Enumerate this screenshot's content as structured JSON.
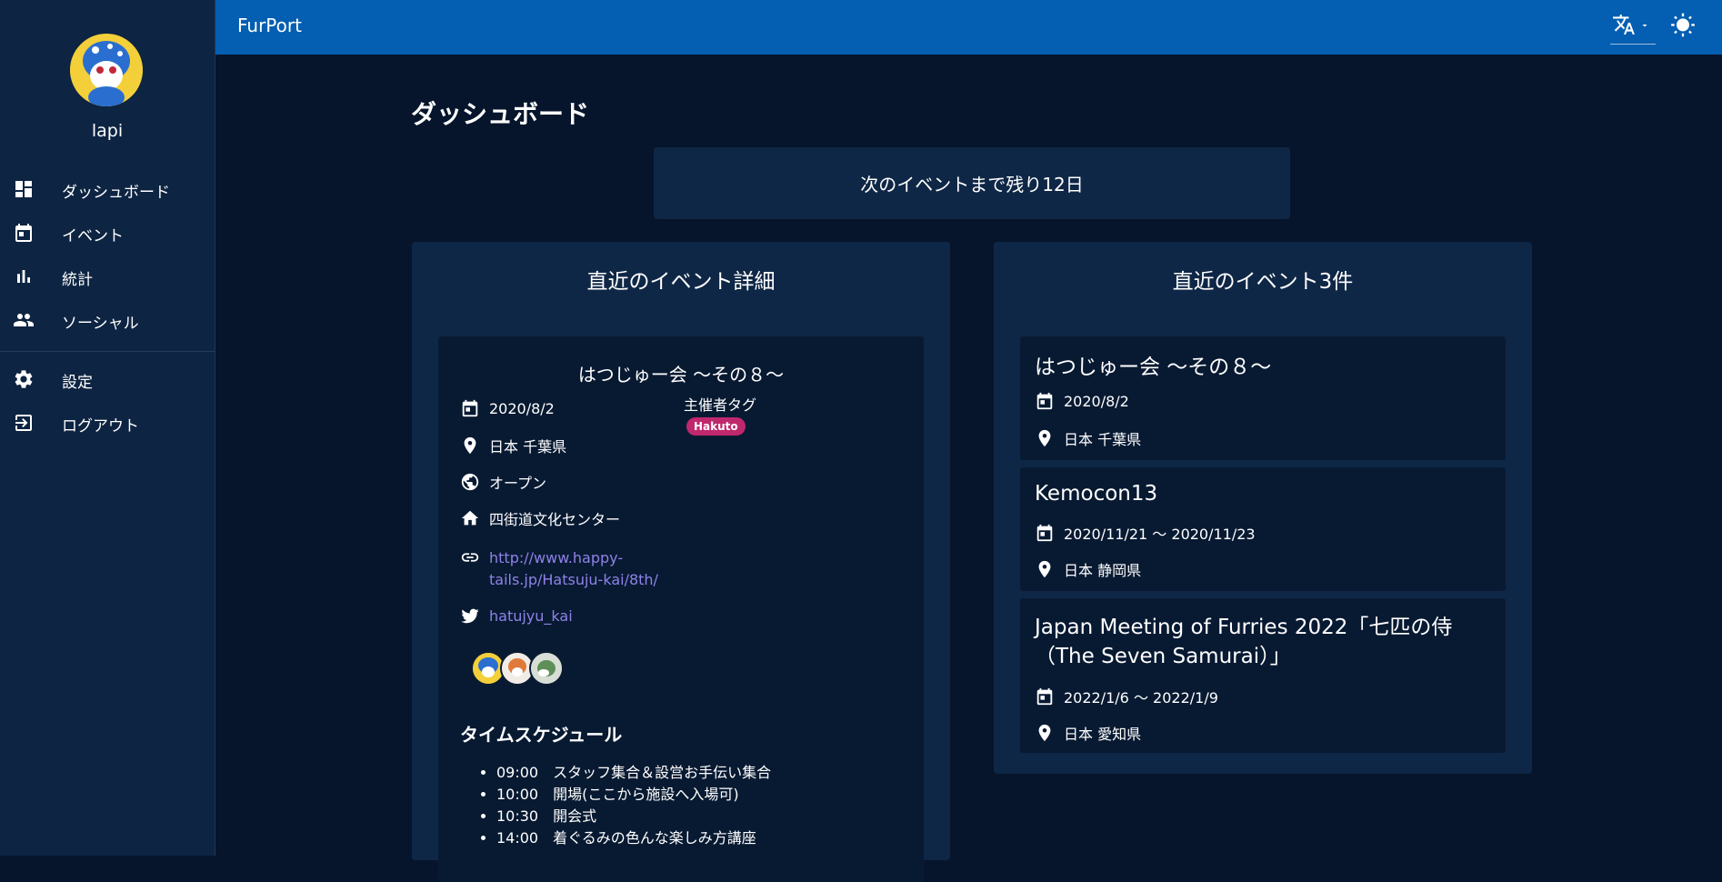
{
  "app": {
    "title": "FurPort"
  },
  "user": {
    "name": "lapi"
  },
  "sidebar": {
    "items": [
      {
        "label": "ダッシュボード",
        "icon": "dashboard-icon"
      },
      {
        "label": "イベント",
        "icon": "calendar-icon"
      },
      {
        "label": "統計",
        "icon": "bar-chart-icon"
      },
      {
        "label": "ソーシャル",
        "icon": "people-icon"
      },
      {
        "label": "設定",
        "icon": "gear-icon"
      },
      {
        "label": "ログアウト",
        "icon": "logout-icon"
      }
    ]
  },
  "header": {
    "translate_icon": "translate-icon",
    "theme_icon": "sun-icon"
  },
  "main": {
    "page_title": "ダッシュボード",
    "countdown": "次のイベントまで残り12日"
  },
  "detail": {
    "card_title": "直近のイベント詳細",
    "event_name": "はつじゅー会 ～その８～",
    "date": "2020/8/2",
    "location": "日本 千葉県",
    "openness": "オープン",
    "venue": "四街道文化センター",
    "url_line1": "http://www.happy-",
    "url_line2": "tails.jp/Hatsuju-kai/8th/",
    "twitter": "hatujyu_kai",
    "organizer_tag_label": "主催者タグ",
    "organizer_tag": "Hakuto",
    "schedule_title": "タイムスケジュール",
    "schedule": [
      "09:00　スタッフ集合＆設営お手伝い集合",
      "10:00　開場(ここから施設へ入場可)",
      "10:30　開会式",
      "14:00　着ぐるみの色んな楽しみ方講座"
    ]
  },
  "upcoming": {
    "card_title": "直近のイベント3件",
    "events": [
      {
        "title": "はつじゅー会 ～その８～",
        "date": "2020/8/2",
        "location": "日本 千葉県"
      },
      {
        "title": "Kemocon13",
        "date": "2020/11/21 ～ 2020/11/23",
        "location": "日本 静岡県"
      },
      {
        "title_line1": "Japan Meeting of Furries 2022「七匹の侍",
        "title_line2": "（The Seven Samurai）」",
        "date": "2022/1/6 ～ 2022/1/9",
        "location": "日本 愛知県"
      }
    ]
  },
  "colors": {
    "appbar": "#045eb2",
    "sidebar": "#0d2442",
    "background": "#06152b",
    "card": "#0f2746",
    "tag": "#c0286d",
    "link": "#8f82e8"
  }
}
